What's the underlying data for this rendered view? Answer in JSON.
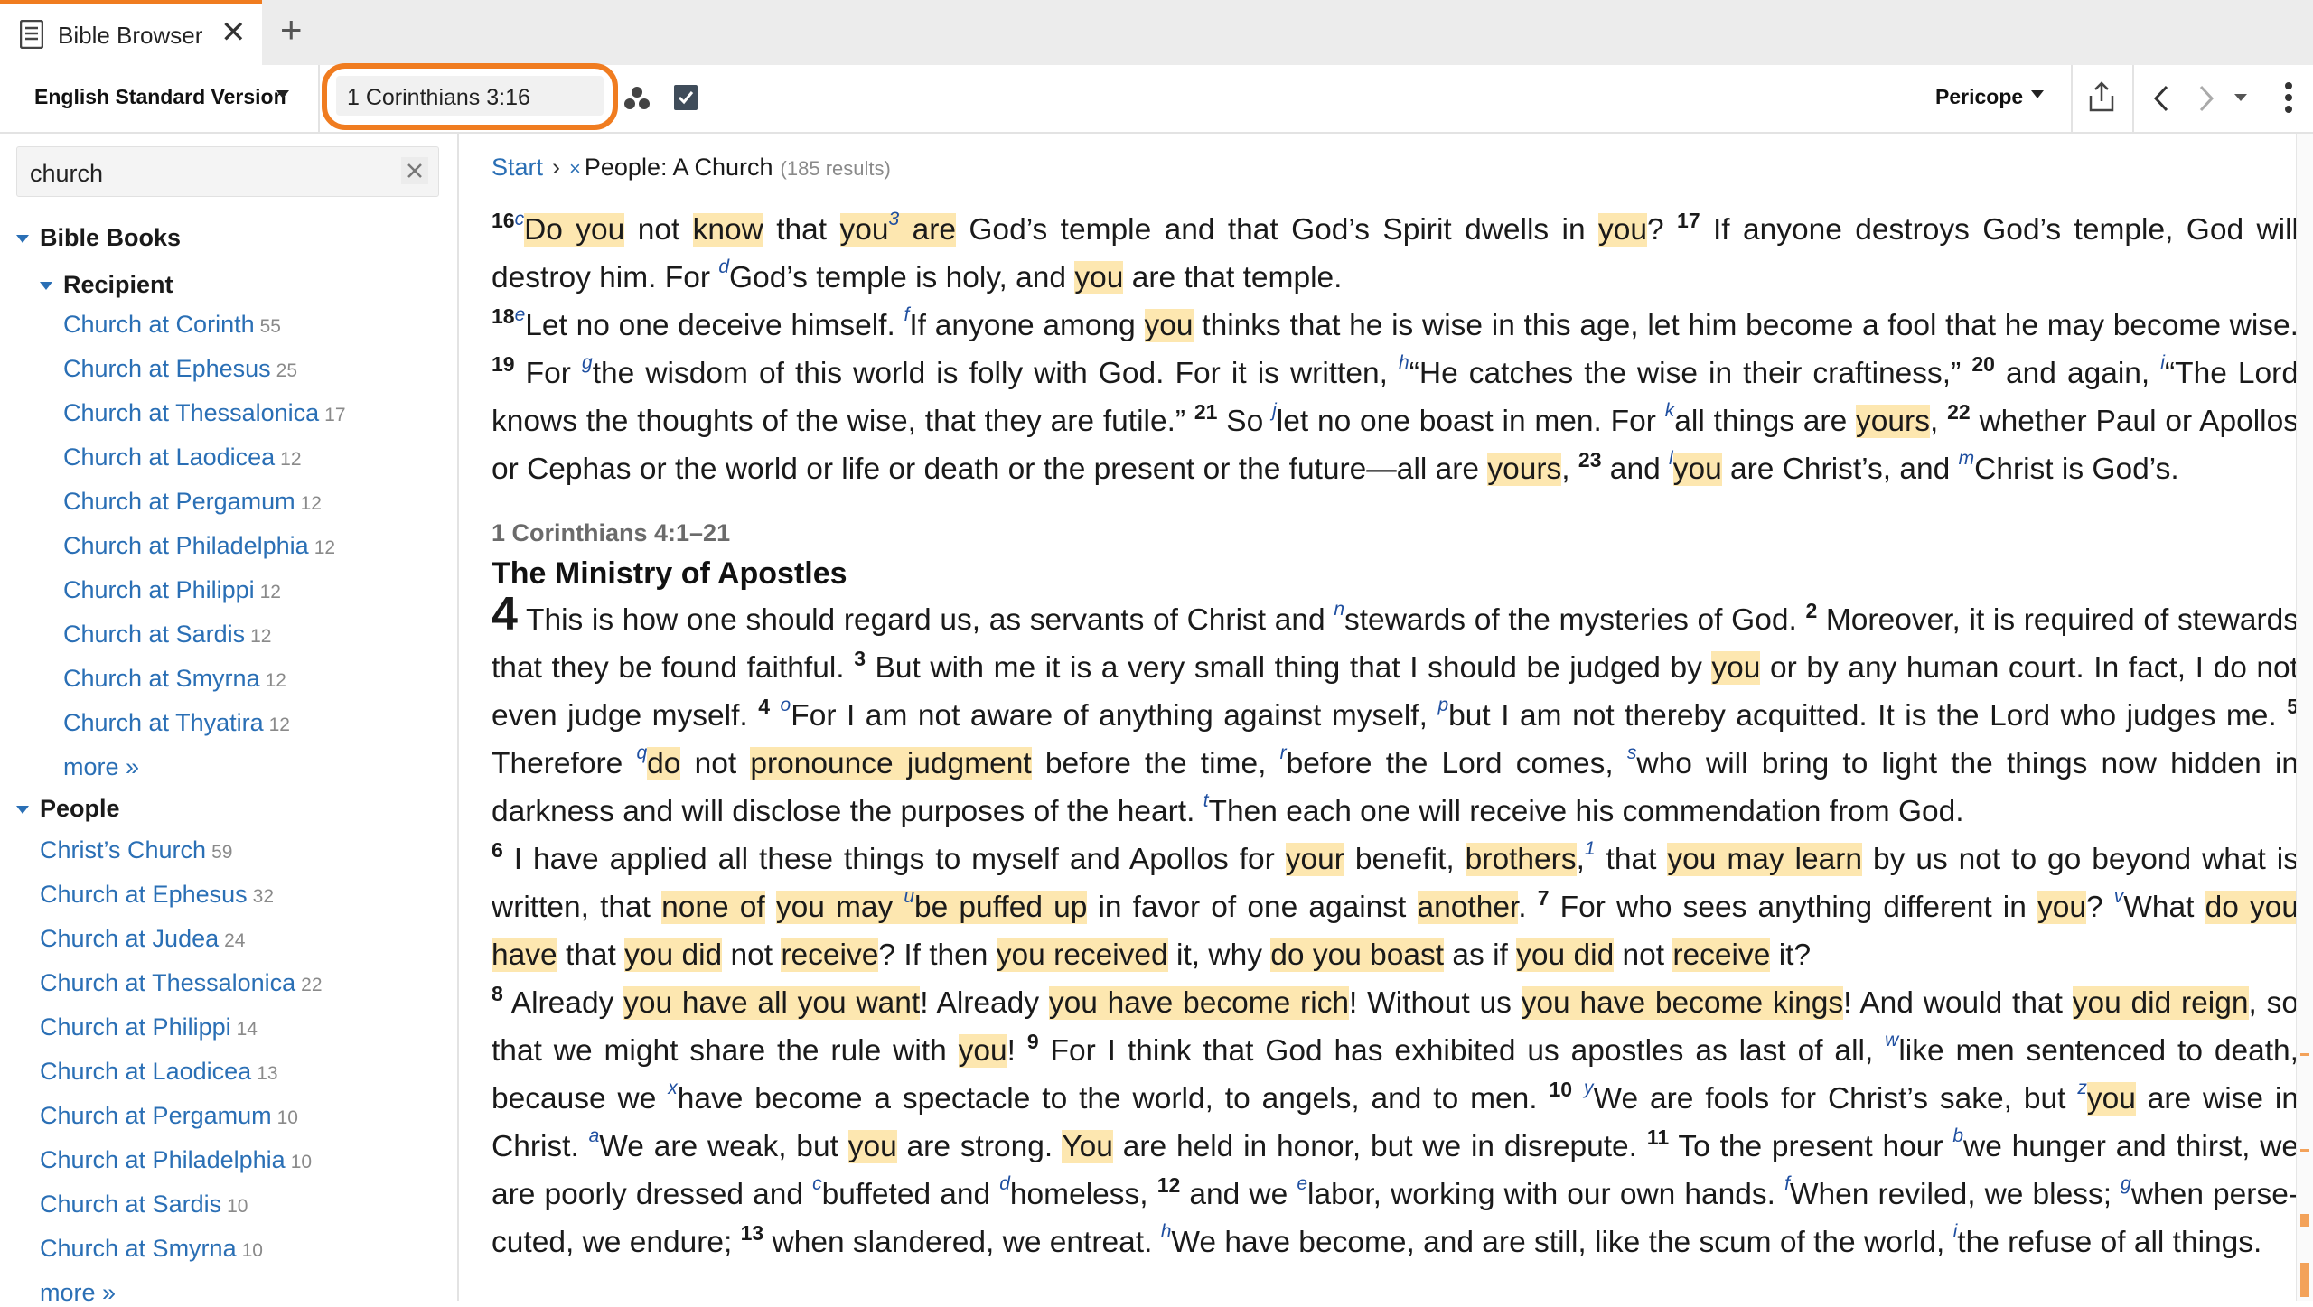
{
  "tab": {
    "title": "Bible Browser",
    "close": "✕",
    "add": "+"
  },
  "toolbar": {
    "version": "English Standard Version",
    "reference": "1 Corinthians 3:16",
    "pericope": "Pericope"
  },
  "sidebar": {
    "search_value": "church",
    "bible_books": {
      "label": "Bible Books",
      "recipient_label": "Recipient",
      "items": [
        {
          "label": "Church at Corinth",
          "count": "55"
        },
        {
          "label": "Church at Ephesus",
          "count": "25"
        },
        {
          "label": "Church at Thessalonica",
          "count": "17"
        },
        {
          "label": "Church at Laodicea",
          "count": "12"
        },
        {
          "label": "Church at Pergamum",
          "count": "12"
        },
        {
          "label": "Church at Philadelphia",
          "count": "12"
        },
        {
          "label": "Church at Philippi",
          "count": "12"
        },
        {
          "label": "Church at Sardis",
          "count": "12"
        },
        {
          "label": "Church at Smyrna",
          "count": "12"
        },
        {
          "label": "Church at Thyatira",
          "count": "12"
        }
      ],
      "more": "more »"
    },
    "people": {
      "label": "People",
      "items": [
        {
          "label": "Christ’s Church",
          "count": "59"
        },
        {
          "label": "Church at Ephesus",
          "count": "32"
        },
        {
          "label": "Church at Judea",
          "count": "24"
        },
        {
          "label": "Church at Thessalonica",
          "count": "22"
        },
        {
          "label": "Church at Philippi",
          "count": "14"
        },
        {
          "label": "Church at Laodicea",
          "count": "13"
        },
        {
          "label": "Church at Pergamum",
          "count": "10"
        },
        {
          "label": "Church at Philadelphia",
          "count": "10"
        },
        {
          "label": "Church at Sardis",
          "count": "10"
        },
        {
          "label": "Church at Smyrna",
          "count": "10"
        }
      ],
      "more": "more »"
    }
  },
  "breadcrumb": {
    "start": "Start",
    "separator": "›",
    "remove": "×",
    "label": "People: A Church",
    "results": "(185 results)"
  },
  "passage": {
    "pericope_ref": "1 Corinthians 4:1–21",
    "section_heading": "The Ministry of Apostles",
    "chapter": "4"
  },
  "colors": {
    "accent": "#f07c20",
    "link": "#2a6fb5",
    "highlight": "#fde7b0",
    "footnote": "#1f4fa0"
  }
}
